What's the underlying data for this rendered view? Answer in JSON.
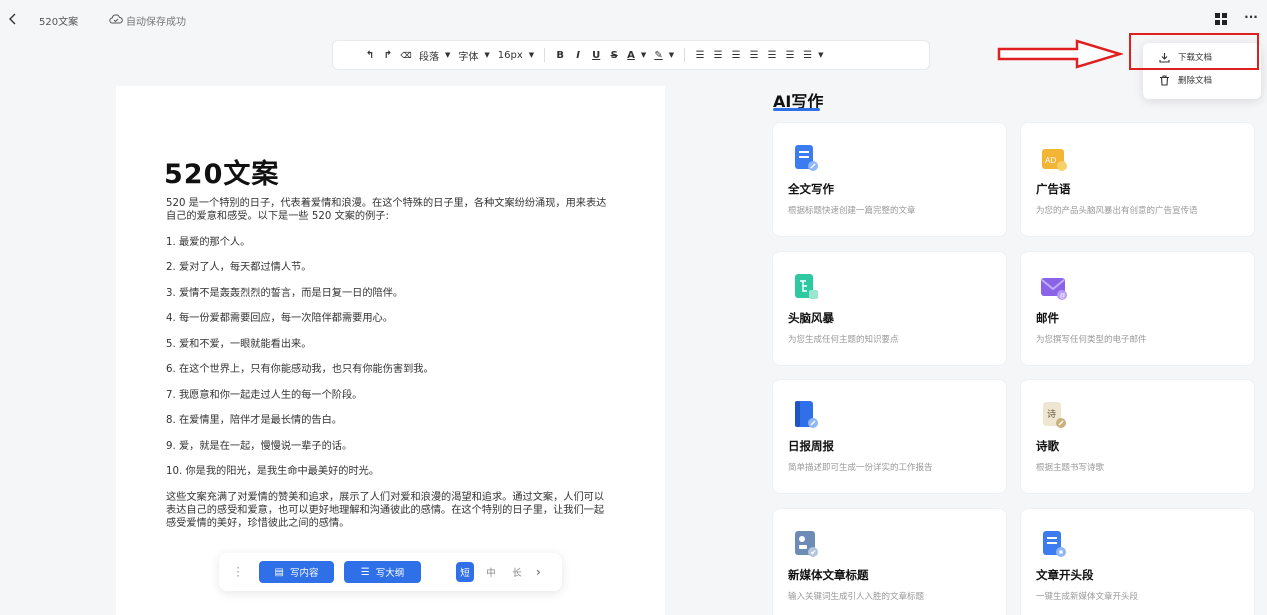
{
  "topbar": {
    "doc_title": "520文案",
    "save_status": "自动保存成功"
  },
  "toolbar": {
    "undo": "↰",
    "redo": "↱",
    "clear_format": "⌫",
    "paragraph": "段落",
    "font": "字体",
    "font_size": "16px",
    "bold": "B",
    "italic": "I",
    "underline": "U",
    "strike": "S",
    "font_color": "A",
    "highlight": "✎"
  },
  "document": {
    "heading": "520文案",
    "intro": "520 是一个特别的日子，代表着爱情和浪漫。在这个特殊的日子里，各种文案纷纷涌现，用来表达自己的爱意和感受。以下是一些 520 文案的例子:",
    "items": [
      "1. 最爱的那个人。",
      "2. 爱对了人，每天都过情人节。",
      "3. 爱情不是轰轰烈烈的誓言，而是日复一日的陪伴。",
      "4. 每一份爱都需要回应，每一次陪伴都需要用心。",
      "5. 爱和不爱，一眼就能看出来。",
      "6. 在这个世界上，只有你能感动我，也只有你能伤害到我。",
      "7. 我愿意和你一起走过人生的每一个阶段。",
      "8. 在爱情里，陪伴才是最长情的告白。",
      "9. 爱，就是在一起，慢慢说一辈子的话。",
      "10. 你是我的阳光，是我生命中最美好的时光。"
    ],
    "conclusion": "这些文案充满了对爱情的赞美和追求，展示了人们对爱和浪漫的渴望和追求。通过文案，人们可以表达自己的感受和爱意，也可以更好地理解和沟通彼此的感情。在这个特别的日子里，让我们一起感受爱情的美好，珍惜彼此之间的感情。"
  },
  "writebar": {
    "write_content": "写内容",
    "write_outline": "写大纲",
    "short": "短",
    "medium": "中",
    "long": "长"
  },
  "ai_panel": {
    "title": "AI写作",
    "cards": [
      {
        "title": "全文写作",
        "desc": "根据标题快速创建一篇完整的文章",
        "icon": "document-pencil-icon",
        "color": "#3b7cf0"
      },
      {
        "title": "广告语",
        "desc": "为您的产品头脑风暴出有创意的广告宣传语",
        "icon": "ad-icon",
        "color": "#f2b535"
      },
      {
        "title": "头脑风暴",
        "desc": "为您生成任何主题的知识要点",
        "icon": "mindmap-icon",
        "color": "#2ec9a0"
      },
      {
        "title": "邮件",
        "desc": "为您撰写任何类型的电子邮件",
        "icon": "mail-icon",
        "color": "#8a63e8"
      },
      {
        "title": "日报周报",
        "desc": "简单描述即可生成一份详实的工作报告",
        "icon": "book-pencil-icon",
        "color": "#2f6fe8"
      },
      {
        "title": "诗歌",
        "desc": "根据主题书写诗歌",
        "icon": "poem-icon",
        "color": "#c9b07a"
      },
      {
        "title": "新媒体文章标题",
        "desc": "输入关键词生成引人入胜的文章标题",
        "icon": "media-title-icon",
        "color": "#6c8bb5"
      },
      {
        "title": "文章开头段",
        "desc": "一键生成新媒体文章开头段",
        "icon": "article-opening-icon",
        "color": "#3b7cf0"
      }
    ]
  },
  "menu": {
    "download": "下载文档",
    "delete": "删除文档"
  }
}
